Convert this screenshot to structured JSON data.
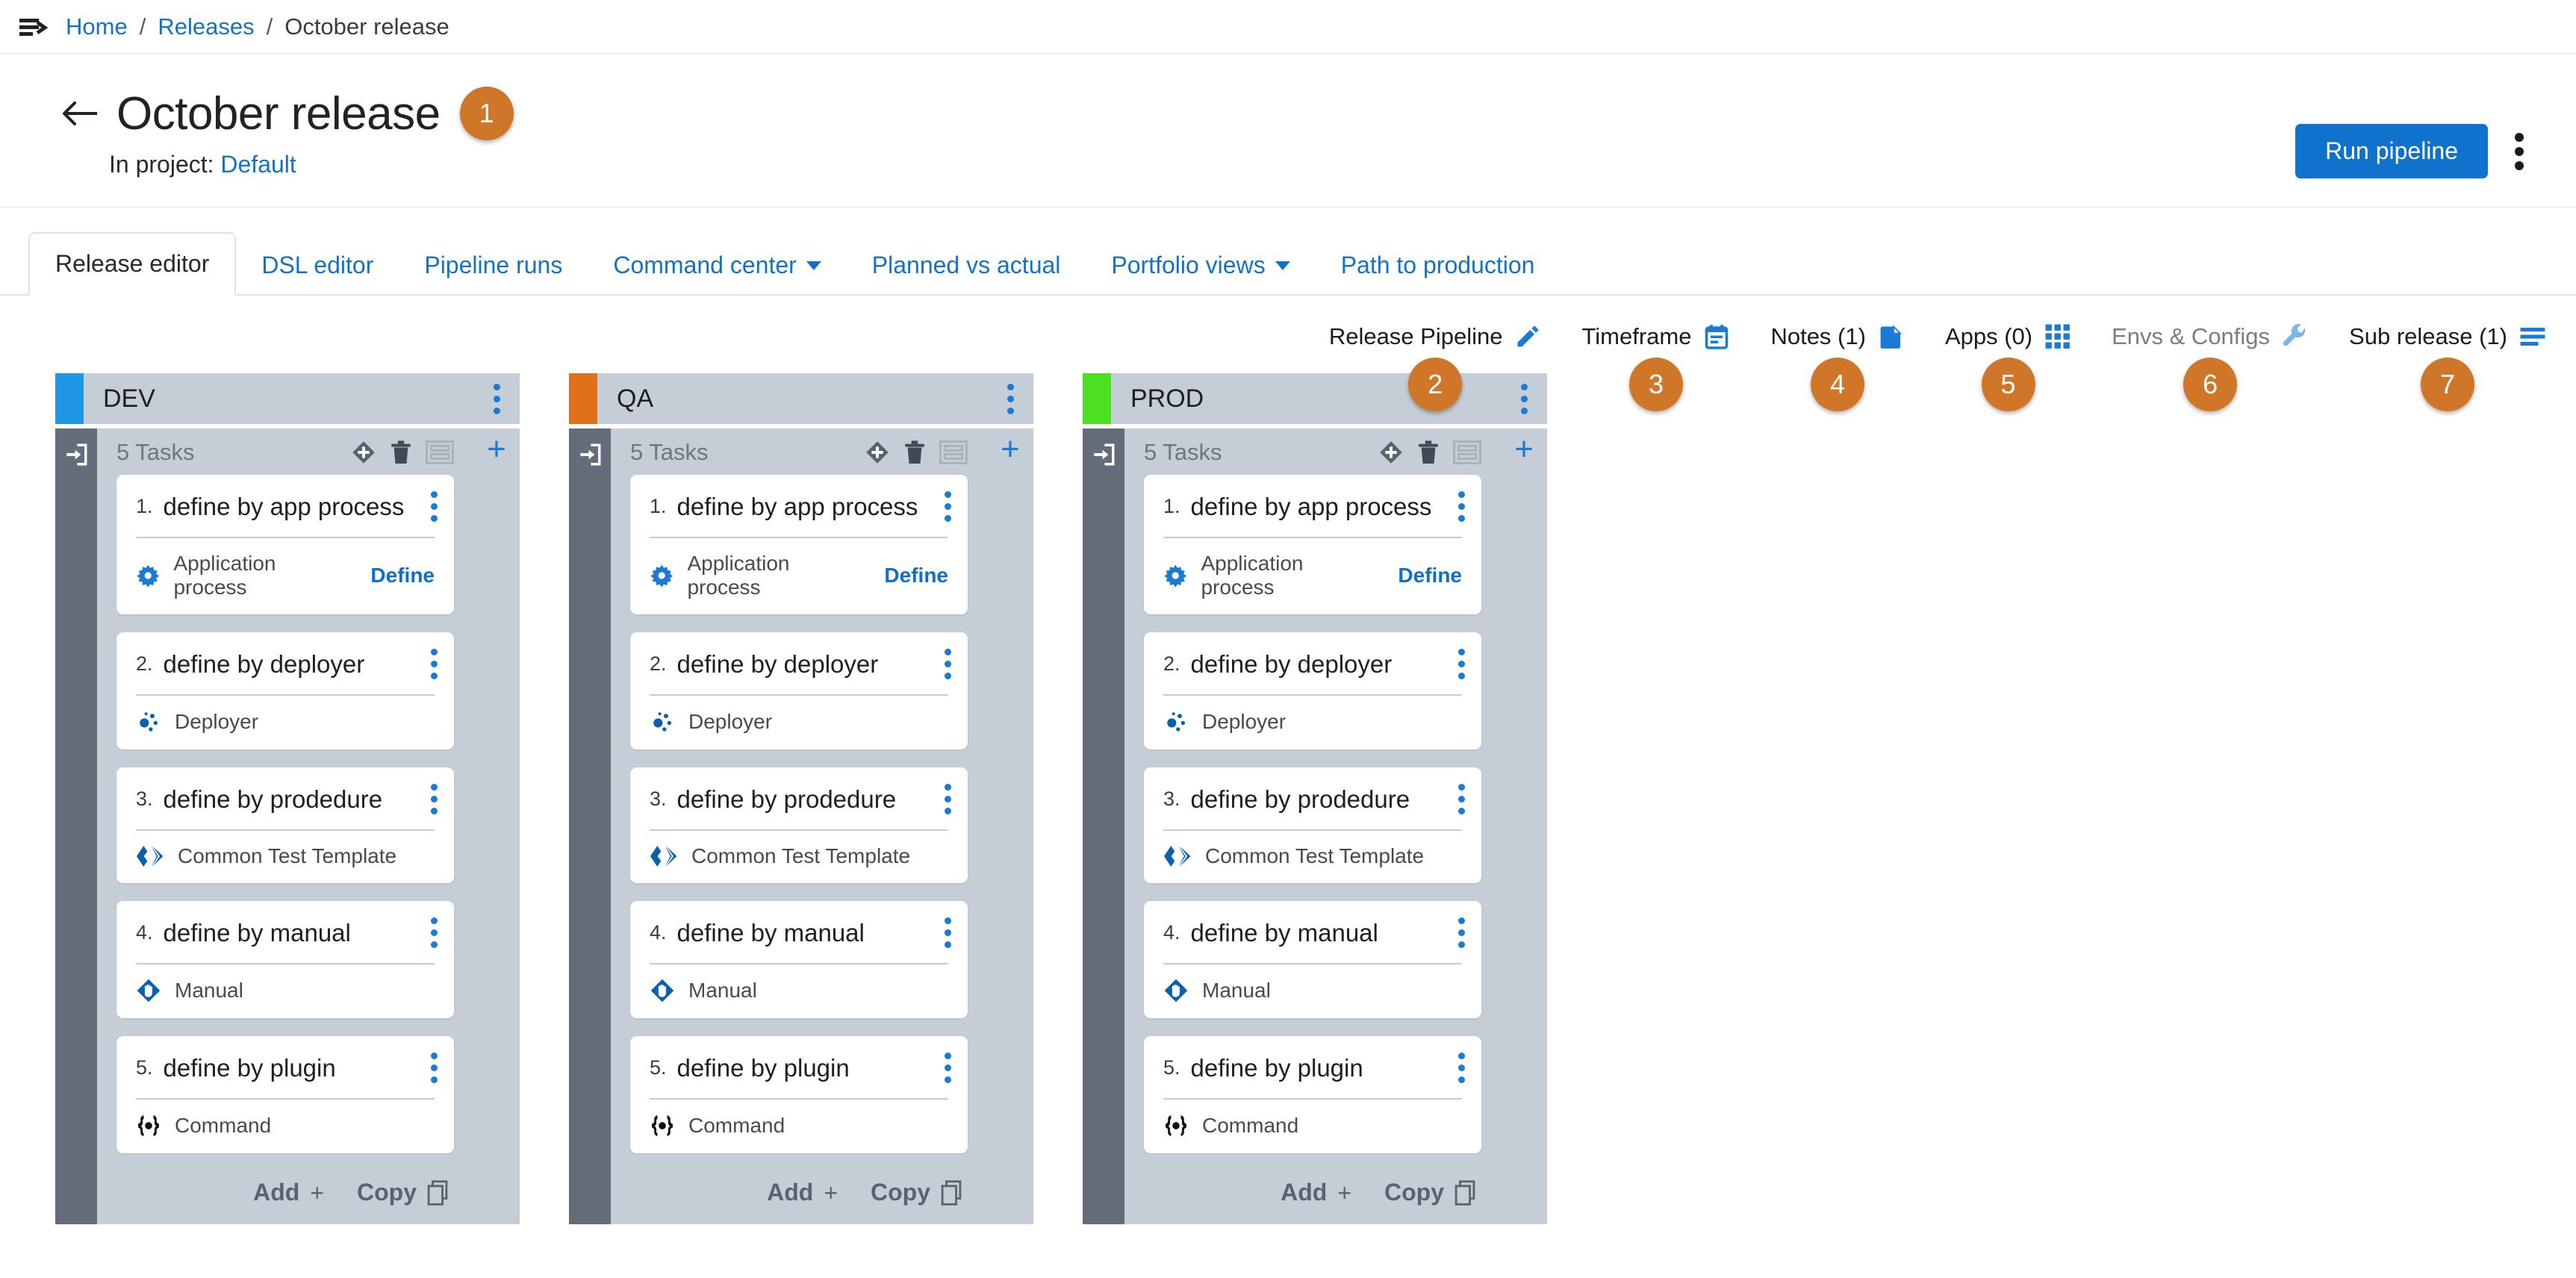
{
  "breadcrumb": {
    "menu_icon": "menu-expand-icon",
    "items": [
      {
        "label": "Home",
        "link": true
      },
      {
        "label": "Releases",
        "link": true
      },
      {
        "label": "October release",
        "link": false
      }
    ],
    "separator": "/"
  },
  "header": {
    "back_icon": "arrow-left-icon",
    "title": "October release",
    "marker": "1",
    "subtitle_prefix": "In project:",
    "project_name": "Default",
    "run_button": "Run pipeline",
    "overflow_icon": "kebab-vertical-icon"
  },
  "tabs": [
    {
      "label": "Release editor",
      "active": true,
      "caret": false
    },
    {
      "label": "DSL editor",
      "active": false,
      "caret": false
    },
    {
      "label": "Pipeline runs",
      "active": false,
      "caret": false
    },
    {
      "label": "Command center",
      "active": false,
      "caret": true
    },
    {
      "label": "Planned vs actual",
      "active": false,
      "caret": false
    },
    {
      "label": "Portfolio views",
      "active": false,
      "caret": true
    },
    {
      "label": "Path to production",
      "active": false,
      "caret": false
    }
  ],
  "toolbar": [
    {
      "label": "Release Pipeline",
      "icon": "pencil-icon",
      "marker": "2",
      "disabled": false
    },
    {
      "label": "Timeframe",
      "icon": "calendar-icon",
      "marker": "3",
      "disabled": false
    },
    {
      "label": "Notes (1)",
      "icon": "document-icon",
      "marker": "4",
      "disabled": false
    },
    {
      "label": "Apps (0)",
      "icon": "grid-icon",
      "marker": "5",
      "disabled": false
    },
    {
      "label": "Envs & Configs",
      "icon": "wrench-icon",
      "marker": "6",
      "disabled": true
    },
    {
      "label": "Sub release (1)",
      "icon": "list-icon",
      "marker": "7",
      "disabled": false
    }
  ],
  "board": {
    "tasks_label": "5 Tasks",
    "header_tools": [
      "gate-diamond-icon",
      "trash-icon",
      "table-view-icon"
    ],
    "rail_icon": "enter-box-icon",
    "add_column_icon": "plus-icon",
    "footer": {
      "add_label": "Add",
      "add_icon": "plus-icon",
      "copy_label": "Copy",
      "copy_icon": "copy-icon"
    },
    "columns": [
      {
        "name": "DEV",
        "accent": "#2196e3",
        "tasks": [
          {
            "num": "1.",
            "title": "define by app process",
            "type": "Application process",
            "icon": "gear-icon",
            "action": "Define"
          },
          {
            "num": "2.",
            "title": "define by deployer",
            "type": "Deployer",
            "icon": "deployer-icon",
            "action": ""
          },
          {
            "num": "3.",
            "title": "define by prodedure",
            "type": "Common Test Template",
            "icon": "chevrons-icon",
            "action": ""
          },
          {
            "num": "4.",
            "title": "define by manual",
            "type": "Manual",
            "icon": "hand-icon",
            "action": ""
          },
          {
            "num": "5.",
            "title": "define by plugin",
            "type": "Command",
            "icon": "command-icon",
            "action": ""
          }
        ]
      },
      {
        "name": "QA",
        "accent": "#e1701a",
        "tasks": [
          {
            "num": "1.",
            "title": "define by app process",
            "type": "Application process",
            "icon": "gear-icon",
            "action": "Define"
          },
          {
            "num": "2.",
            "title": "define by deployer",
            "type": "Deployer",
            "icon": "deployer-icon",
            "action": ""
          },
          {
            "num": "3.",
            "title": "define by prodedure",
            "type": "Common Test Template",
            "icon": "chevrons-icon",
            "action": ""
          },
          {
            "num": "4.",
            "title": "define by manual",
            "type": "Manual",
            "icon": "hand-icon",
            "action": ""
          },
          {
            "num": "5.",
            "title": "define by plugin",
            "type": "Command",
            "icon": "command-icon",
            "action": ""
          }
        ]
      },
      {
        "name": "PROD",
        "accent": "#4ce023",
        "tasks": [
          {
            "num": "1.",
            "title": "define by app process",
            "type": "Application process",
            "icon": "gear-icon",
            "action": "Define"
          },
          {
            "num": "2.",
            "title": "define by deployer",
            "type": "Deployer",
            "icon": "deployer-icon",
            "action": ""
          },
          {
            "num": "3.",
            "title": "define by prodedure",
            "type": "Common Test Template",
            "icon": "chevrons-icon",
            "action": ""
          },
          {
            "num": "4.",
            "title": "define by manual",
            "type": "Manual",
            "icon": "hand-icon",
            "action": ""
          },
          {
            "num": "5.",
            "title": "define by plugin",
            "type": "Command",
            "icon": "command-icon",
            "action": ""
          }
        ]
      }
    ]
  },
  "colors": {
    "link_blue": "#1471c4",
    "primary_blue": "#0f72cc",
    "marker_orange": "#cf7628",
    "column_grey": "#c5ced6",
    "rail_grey": "#636c78"
  }
}
